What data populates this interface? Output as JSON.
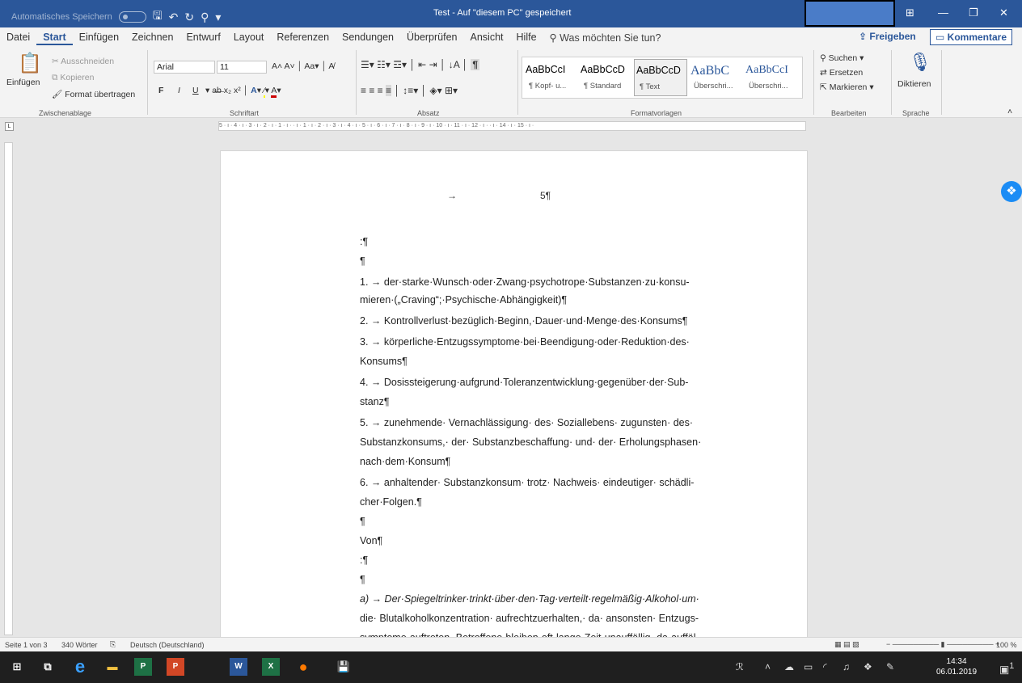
{
  "title_bar": {
    "autosave_label": "Automatisches Speichern",
    "document_title": "Test  -  Auf \"diesem PC\" gespeichert"
  },
  "menu": {
    "tabs": [
      "Datei",
      "Start",
      "Einfügen",
      "Zeichnen",
      "Entwurf",
      "Layout",
      "Referenzen",
      "Sendungen",
      "Überprüfen",
      "Ansicht",
      "Hilfe"
    ],
    "search_label": "Was möchten Sie tun?",
    "share_label": "Freigeben",
    "comments_label": "Kommentare"
  },
  "ribbon": {
    "clipboard": {
      "paste": "Einfügen",
      "cut": "Ausschneiden",
      "copy": "Kopieren",
      "format_painter": "Format übertragen",
      "label": "Zwischenablage"
    },
    "font": {
      "name": "Arial",
      "size": "11",
      "bold": "F",
      "italic": "I",
      "underline": "U",
      "label": "Schriftart"
    },
    "paragraph": {
      "label": "Absatz"
    },
    "styles": {
      "label": "Formatvorlagen",
      "items": [
        {
          "sample": "AaBbCcI",
          "name": "¶ Kopf- u..."
        },
        {
          "sample": "AaBbCcD",
          "name": "¶ Standard"
        },
        {
          "sample": "AaBbCcD",
          "name": "¶ Text"
        },
        {
          "sample": "AaBbC",
          "name": "Überschri..."
        },
        {
          "sample": "AaBbCcI",
          "name": "Überschri..."
        }
      ]
    },
    "editing": {
      "search": "Suchen",
      "replace": "Ersetzen",
      "select": "Markieren",
      "label": "Bearbeiten"
    },
    "voice": {
      "dictate": "Diktieren",
      "label": "Sprache"
    }
  },
  "ruler": {
    "horizontal": "5 · ı · 4 · ı · 3 · ı · 2 · ı · 1 · ı ·    · ı · 1 · ı · 2 · ı · 3 · ı · 4 · ı · 5 · ı · 6 · ı · 7 · ı · 8 · ı · 9 · ı · 10 · ı · 11 · ı · 12 · ı ·   · ı · 14 · ı · 15 · ı ·"
  },
  "document": {
    "header_tab": "→",
    "header_page": "5¶",
    "lines": [
      ":¶",
      "¶",
      "1.  →  der·starke·Wunsch·oder·Zwang·psychotrope·Substanzen·zu·konsu-",
      "mieren·(„Craving“;·Psychische·Abhängigkeit)¶",
      "2.  →  Kontrollverlust·bezüglich·Beginn,·Dauer·und·Menge·des·Konsums¶",
      "3.  →  körperliche·Entzugssymptome·bei·Beendigung·oder·Reduktion·des·",
      "Konsums¶",
      "4.  →  Dosissteigerung·aufgrund·Toleranzentwicklung·gegenüber·der·Sub-",
      "stanz¶",
      "5.  →  zunehmende· Vernachlässigung· des· Soziallebens· zugunsten· des·",
      "Substanzkonsums,· der· Substanzbeschaffung· und· der· Erholungsphasen·",
      "nach·dem·Konsum¶",
      "6.  →  anhaltender· Substanzkonsum· trotz· Nachweis· eindeutiger· schädli-",
      "cher·Folgen.¶",
      "¶",
      "Von¶",
      ":¶",
      "¶",
      "a)  →  Der·Spiegeltrinker·trinkt·über·den·Tag·verteilt·regelmäßig·Alkohol·um·",
      "die· Blutalkoholkonzentration· aufrechtzuerhalten,· da· ansonsten· Entzugs-",
      "symptome·auftreten.·Betroffene·bleiben·oft·lange·Zeit·unauffällig,·da·auffäl-"
    ]
  },
  "status": {
    "page": "Seite 1 von 3",
    "words": "340 Wörter",
    "language": "Deutsch (Deutschland)",
    "zoom": "100 %"
  },
  "taskbar": {
    "time": "14:34",
    "date": "06.01.2019",
    "notifications": "1"
  }
}
